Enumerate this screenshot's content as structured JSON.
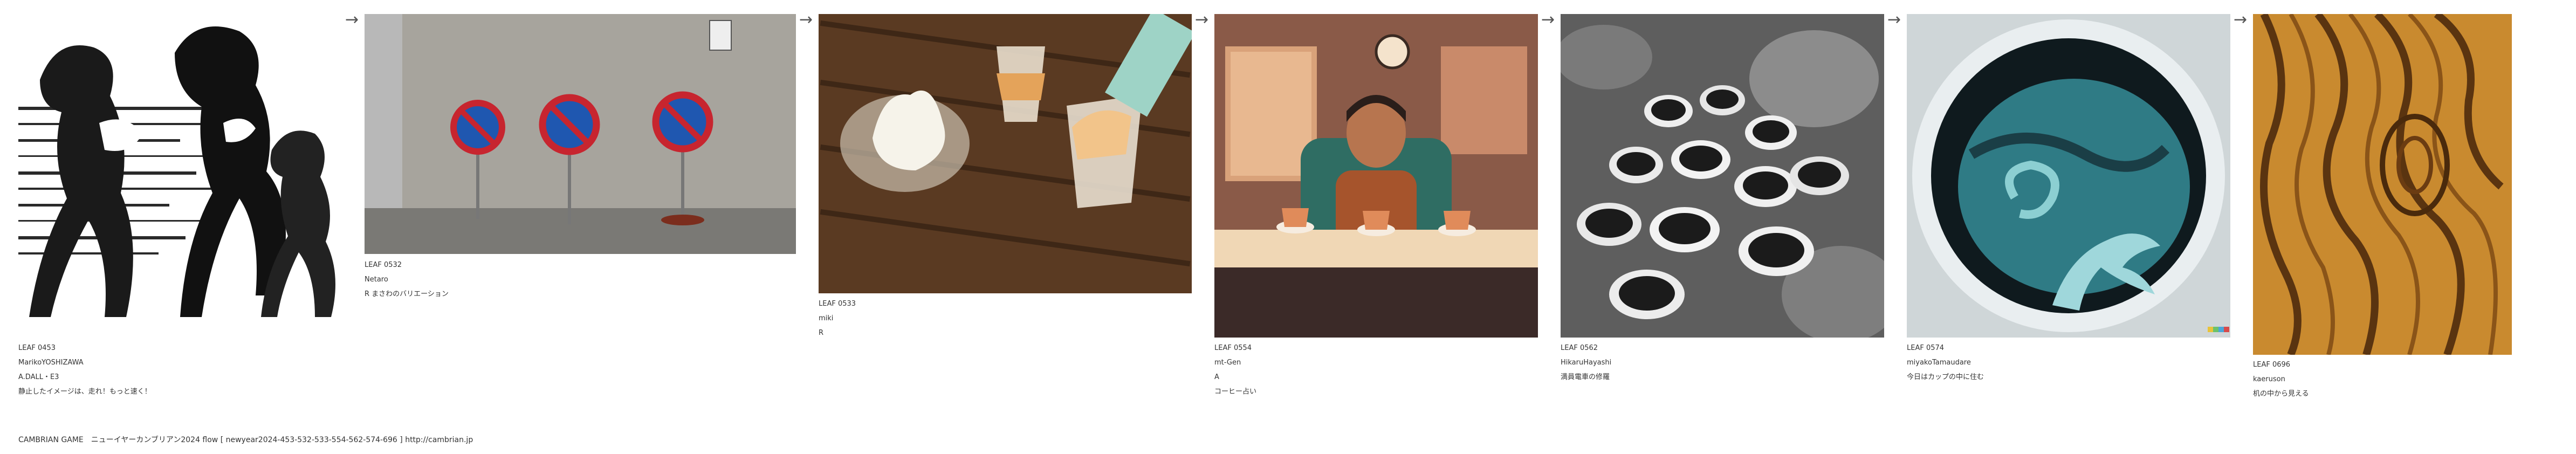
{
  "cards": [
    {
      "code": "LEAF 0453",
      "author": "MarikoYOSHIZAWA",
      "line3": "A.DALL・E3",
      "line4": "静止したイメージは、走れ！もっと速く！",
      "image_icon": "running-women-ink-icon"
    },
    {
      "code": "LEAF 0532",
      "author": "Netaro",
      "line3": "R まさわのバリエーション",
      "line4": "",
      "image_icon": "no-parking-signs-icon"
    },
    {
      "code": "LEAF 0533",
      "author": "miki",
      "line3": "R",
      "line4": "",
      "image_icon": "ice-cream-parfait-icon"
    },
    {
      "code": "LEAF 0554",
      "author": "mt-Gen",
      "line3": "A",
      "line4": "コーヒー占い",
      "image_icon": "coffee-worry-illustration-icon"
    },
    {
      "code": "LEAF 0562",
      "author": "HikaruHayashi",
      "line3": "満員電車の修羅",
      "line4": "",
      "image_icon": "coffee-cups-rocks-icon"
    },
    {
      "code": "LEAF 0574",
      "author": "miyakoTamaudare",
      "line3": "今日はカップの中に住む",
      "line4": "",
      "image_icon": "whale-tail-in-cup-icon"
    },
    {
      "code": "LEAF 0696",
      "author": "kaeruson",
      "line3": "机の中から見える",
      "line4": "",
      "image_icon": "wood-grain-icon"
    }
  ],
  "arrow_glyph": "→",
  "footer": {
    "text": "CAMBRIAN GAME　ニューイヤーカンブリアン2024  flow [ newyear2024-453-532-533-554-562-574-696 ]    http://cambrian.jp"
  },
  "colors": {
    "background": "#ffffff",
    "text": "#333333"
  }
}
